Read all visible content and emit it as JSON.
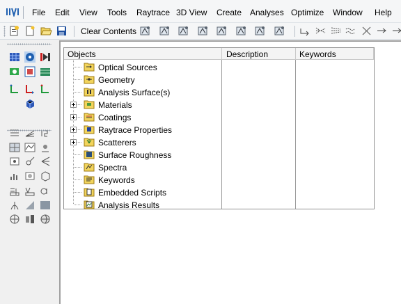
{
  "menubar": {
    "items": [
      {
        "label": "File",
        "name": "menu-file"
      },
      {
        "label": "Edit",
        "name": "menu-edit"
      },
      {
        "label": "View",
        "name": "menu-view"
      },
      {
        "label": "Tools",
        "name": "menu-tools"
      },
      {
        "label": "Raytrace",
        "name": "menu-raytrace"
      },
      {
        "label": "3D View",
        "name": "menu-3d-view"
      },
      {
        "label": "Create",
        "name": "menu-create"
      },
      {
        "label": "Analyses",
        "name": "menu-analyses"
      },
      {
        "label": "Optimize",
        "name": "menu-optimize"
      },
      {
        "label": "Window",
        "name": "menu-window"
      },
      {
        "label": "Help",
        "name": "menu-help"
      }
    ]
  },
  "toolbar": {
    "clear_label": "Clear Contents"
  },
  "tree": {
    "columns": {
      "objects": "Objects",
      "description": "Description",
      "keywords": "Keywords"
    },
    "rows": [
      {
        "label": "Optical Sources",
        "icon": "optical-sources-icon",
        "expandable": false
      },
      {
        "label": "Geometry",
        "icon": "geometry-icon",
        "expandable": false
      },
      {
        "label": "Analysis Surface(s)",
        "icon": "analysis-surface-icon",
        "expandable": false
      },
      {
        "label": "Materials",
        "icon": "materials-icon",
        "expandable": true
      },
      {
        "label": "Coatings",
        "icon": "coatings-icon",
        "expandable": true
      },
      {
        "label": "Raytrace Properties",
        "icon": "raytrace-properties-icon",
        "expandable": true
      },
      {
        "label": "Scatterers",
        "icon": "scatterers-icon",
        "expandable": true
      },
      {
        "label": "Surface Roughness",
        "icon": "surface-roughness-icon",
        "expandable": false
      },
      {
        "label": "Spectra",
        "icon": "spectra-icon",
        "expandable": false
      },
      {
        "label": "Keywords",
        "icon": "keywords-icon",
        "expandable": false
      },
      {
        "label": "Embedded Scripts",
        "icon": "embedded-scripts-icon",
        "expandable": false
      },
      {
        "label": "Analysis Results",
        "icon": "analysis-results-icon",
        "expandable": false
      }
    ]
  },
  "colors": {
    "folder": "#f2d45c",
    "folder_edge": "#9c7a14",
    "accent_blue": "#1e5fb0",
    "accent_red": "#cc1f1f",
    "accent_green": "#1f9a3a"
  }
}
